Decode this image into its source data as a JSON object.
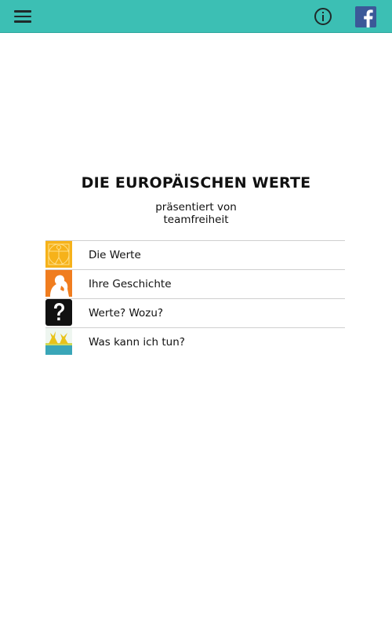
{
  "header": {
    "menu_icon": "hamburger-menu-icon",
    "info_icon": "info-circle-icon",
    "facebook_icon": "facebook-icon",
    "bar_color": "#3cbfb4",
    "facebook_color": "#3b5998"
  },
  "main": {
    "title": "DIE EUROPÄISCHEN WERTE",
    "subtitle_line1": "präsentiert von",
    "subtitle_line2": "teamfreiheit",
    "items": [
      {
        "label": "Die Werte",
        "icon": "vitruvian-man-icon",
        "color": "#f6b21a"
      },
      {
        "label": "Ihre Geschichte",
        "icon": "history-figure-icon",
        "color": "#f07d1f"
      },
      {
        "label": "Werte? Wozu?",
        "icon": "question-mark-icon",
        "color": "#111111"
      },
      {
        "label": "Was kann ich tun?",
        "icon": "people-action-icon",
        "color": "#3aa6b8"
      }
    ]
  }
}
